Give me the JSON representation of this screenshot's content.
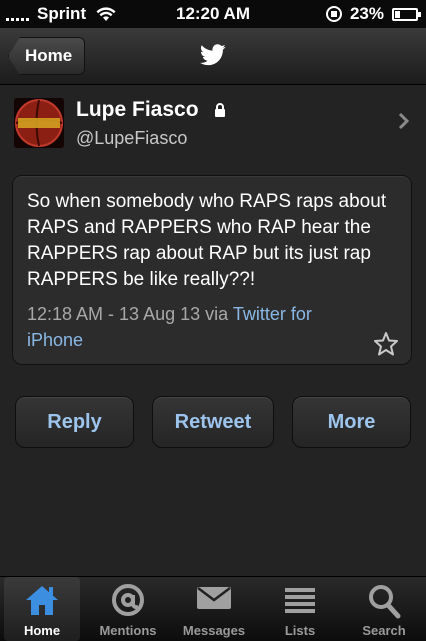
{
  "status_bar": {
    "carrier": "Sprint",
    "time": "12:20 AM",
    "battery": "23%",
    "battery_level": 0.23
  },
  "nav": {
    "back_label": "Home",
    "logo_icon": "twitter-bird-icon"
  },
  "profile": {
    "name": "Lupe Fiasco",
    "handle": "@LupeFiasco",
    "protected_icon": "lock-icon"
  },
  "tweet": {
    "text": "So when somebody who RAPS raps about RAPS and RAPPERS who RAP hear the RAPPERS rap about RAP but its just rap RAPPERS be like really??!",
    "timestamp": "12:18 AM - 13 Aug 13",
    "via": "via",
    "source": "Twitter for iPhone"
  },
  "actions": {
    "reply": "Reply",
    "retweet": "Retweet",
    "more": "More"
  },
  "tabs": [
    {
      "label": "Home",
      "icon": "home-icon",
      "active": true
    },
    {
      "label": "Mentions",
      "icon": "at-icon",
      "active": false
    },
    {
      "label": "Messages",
      "icon": "envelope-icon",
      "active": false
    },
    {
      "label": "Lists",
      "icon": "list-icon",
      "active": false
    },
    {
      "label": "Search",
      "icon": "search-icon",
      "active": false
    }
  ],
  "colors": {
    "accent": "#9cc4ec",
    "link": "#8ab8e6",
    "active_tab": "#3b8ee0"
  }
}
